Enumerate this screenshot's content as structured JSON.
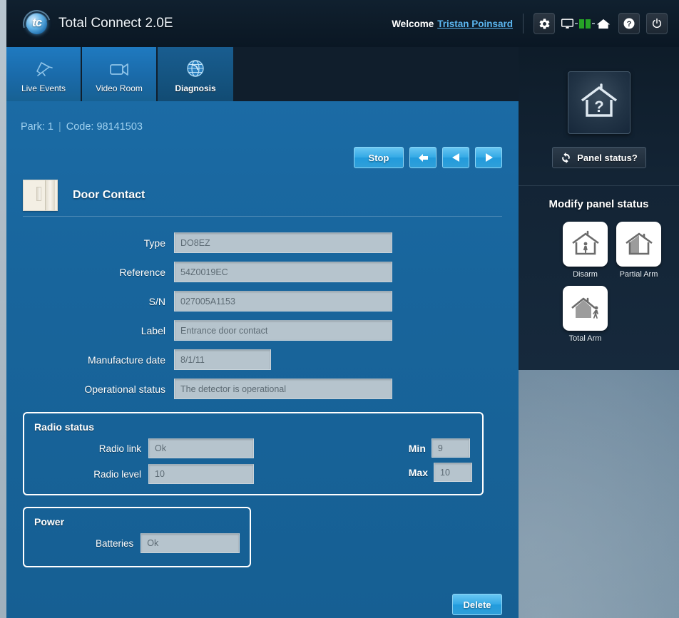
{
  "header": {
    "brand_title": "Total Connect 2.0E",
    "logo_text": "tc",
    "welcome_text": "Welcome",
    "user_name": "Tristan Poinsard",
    "icons": {
      "settings": "gear-icon",
      "connection": "connection-status-icon",
      "help": "help-icon",
      "power": "power-icon"
    }
  },
  "tabs": [
    {
      "label": "Live Events",
      "icon": "alarm-bell-icon",
      "active": false
    },
    {
      "label": "Video Room",
      "icon": "video-camera-icon",
      "active": false
    },
    {
      "label": "Diagnosis",
      "icon": "globe-icon",
      "active": true
    }
  ],
  "breadcrumb": {
    "park_label": "Park: 1",
    "separator": "|",
    "code_label": "Code: 98141503"
  },
  "controls": {
    "stop_label": "Stop",
    "first_icon": "arrow-left-bold-icon",
    "prev_icon": "triangle-left-icon",
    "next_icon": "triangle-right-icon"
  },
  "device": {
    "title": "Door Contact",
    "thumb_icon": "door-contact-sensor-image",
    "fields": [
      {
        "label": "Type",
        "value": "DO8EZ",
        "width": "lg"
      },
      {
        "label": "Reference",
        "value": "54Z0019EC",
        "width": "lg"
      },
      {
        "label": "S/N",
        "value": "027005A1153",
        "width": "lg"
      },
      {
        "label": "Label",
        "value": "Entrance door contact",
        "width": "lg"
      },
      {
        "label": "Manufacture date",
        "value": "8/1/11",
        "width": "md"
      },
      {
        "label": "Operational status",
        "value": "The detector is operational",
        "width": "lg"
      }
    ],
    "radio_status": {
      "title": "Radio status",
      "radio_link_label": "Radio link",
      "radio_link_value": "Ok",
      "radio_level_label": "Radio level",
      "radio_level_value": "10",
      "min_label": "Min",
      "min_value": "9",
      "max_label": "Max",
      "max_value": "10"
    },
    "power": {
      "title": "Power",
      "batteries_label": "Batteries",
      "batteries_value": "Ok"
    },
    "delete_label": "Delete"
  },
  "sidebar": {
    "panel_icon": "house-question-mark-icon",
    "panel_status_label": "Panel status?",
    "panel_status_icon": "refresh-icon",
    "modify_heading": "Modify panel status",
    "arm_options": [
      {
        "label": "Disarm",
        "icon": "house-person-inside-icon"
      },
      {
        "label": "Partial Arm",
        "icon": "house-partial-shaded-icon"
      },
      {
        "label": "Total Arm",
        "icon": "house-person-outside-icon"
      }
    ]
  },
  "colors": {
    "accent_blue": "#1b6ba5",
    "header_dark": "#0d1b28",
    "link_blue": "#5bb6f0",
    "button_blue": "#35aae6",
    "status_green": "#26a326"
  }
}
